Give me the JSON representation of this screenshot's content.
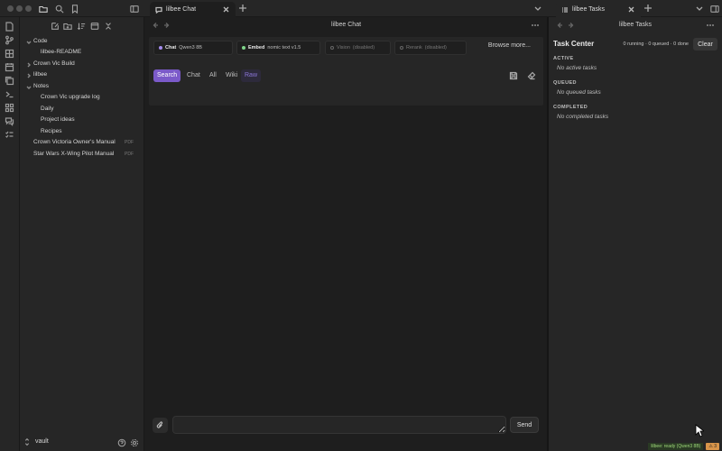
{
  "tabs": {
    "chat_tab": "lilbee Chat",
    "tasks_tab": "lilbee Tasks"
  },
  "explorer": {
    "items": [
      {
        "label": "Code",
        "type": "folder",
        "expanded": true
      },
      {
        "label": "lilbee-README",
        "type": "file"
      },
      {
        "label": "Crown Vic Build",
        "type": "folder",
        "expanded": false
      },
      {
        "label": "lilbee",
        "type": "folder",
        "expanded": false
      },
      {
        "label": "Notes",
        "type": "folder",
        "expanded": true
      },
      {
        "label": "Crown Vic upgrade log",
        "type": "file"
      },
      {
        "label": "Daily",
        "type": "file"
      },
      {
        "label": "Project ideas",
        "type": "file"
      },
      {
        "label": "Recipes",
        "type": "file"
      },
      {
        "label": "Crown Victoria Owner's Manual",
        "type": "file",
        "tag": "PDF"
      },
      {
        "label": "Star Wars X-Wing Pilot Manual",
        "type": "file",
        "tag": "PDF"
      }
    ],
    "vault_name": "vault"
  },
  "chat": {
    "title": "lilbee Chat",
    "models": {
      "chat": {
        "name": "Chat",
        "value": "Qwen3 8B",
        "status": "active",
        "color": "#a58cf0"
      },
      "embed": {
        "name": "Embed",
        "value": "nomic text v1.5",
        "status": "active",
        "color": "#7fd58a"
      },
      "vision": {
        "name": "Vision",
        "value": "(disabled)",
        "status": "disabled"
      },
      "rerank": {
        "name": "Rerank",
        "value": "(disabled)",
        "status": "disabled"
      }
    },
    "browse_label": "Browse more...",
    "modes": [
      "Search",
      "Chat",
      "All",
      "Wiki",
      "Raw"
    ],
    "active_mode": "Search",
    "input_placeholder": "",
    "send_label": "Send"
  },
  "tasks": {
    "title": "lilbee Tasks",
    "center_title": "Task Center",
    "summary": "0 running · 0 queued · 0 done",
    "clear_label": "Clear",
    "sections": [
      {
        "heading": "ACTIVE",
        "empty": "No active tasks"
      },
      {
        "heading": "QUEUED",
        "empty": "No queued tasks"
      },
      {
        "heading": "COMPLETED",
        "empty": "No completed tasks"
      }
    ]
  },
  "status": {
    "ready": "lilbee: ready (Qwen3 8B)",
    "badge": "⚠ 3"
  },
  "colors": {
    "accent": "#7b5ac9",
    "raw_text": "#8b76d8",
    "status_ready": "#9ed87a",
    "status_badge": "#d8954a"
  }
}
